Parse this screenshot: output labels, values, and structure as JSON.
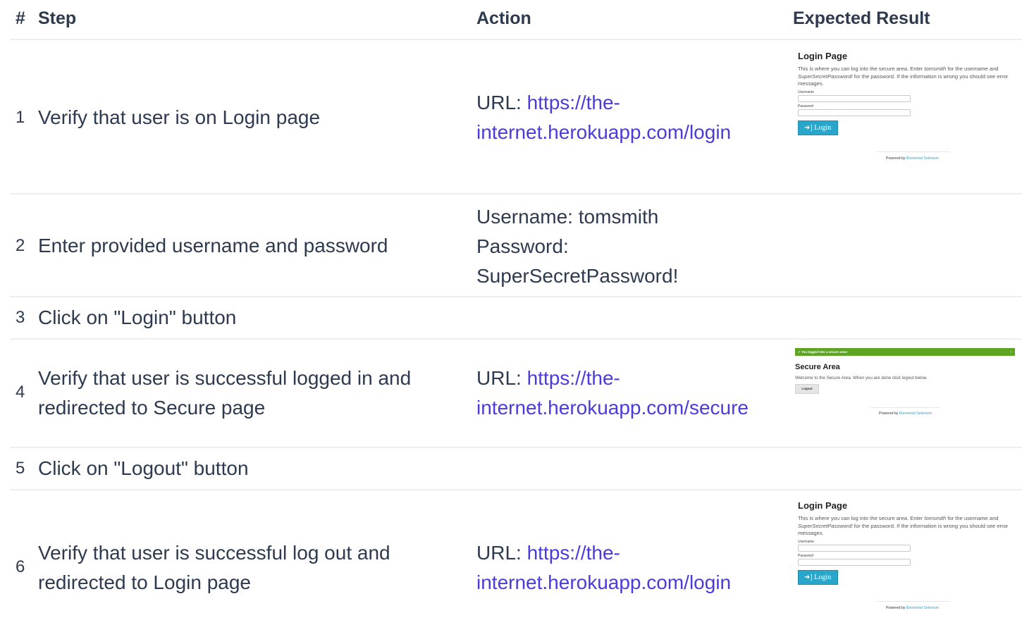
{
  "headers": {
    "num": "#",
    "step": "Step",
    "action": "Action",
    "expected": "Expected Result"
  },
  "rows": [
    {
      "num": "1",
      "step": "Verify that user is on Login page",
      "action_prefix": "URL: ",
      "action_link": "https://the-internet.herokuapp.com/login"
    },
    {
      "num": "2",
      "step": "Enter provided username and password",
      "action_lines": [
        "Username: tomsmith",
        "Password:",
        "SuperSecretPassword!"
      ]
    },
    {
      "num": "3",
      "step": "Click on \"Login\" button"
    },
    {
      "num": "4",
      "step": "Verify that user is successful logged in and redirected to Secure page",
      "action_prefix": "URL: ",
      "action_link": "https://the-internet.herokuapp.com/secure"
    },
    {
      "num": "5",
      "step": "Click on \"Logout\" button"
    },
    {
      "num": "6",
      "step": "Verify that user is successful log out and redirected to Login page",
      "action_prefix": "URL: ",
      "action_link": "https://the-internet.herokuapp.com/login"
    }
  ],
  "login_shot": {
    "title": "Login Page",
    "desc_1": "This is where you can log into the secure area. Enter ",
    "desc_user": "tomsmith",
    "desc_2": " for the username and ",
    "desc_pass": "SuperSecretPassword!",
    "desc_3": " for the password. If the information is wrong you should see error messages.",
    "username_label": "Username",
    "password_label": "Password",
    "button": "Login",
    "footer_prefix": "Powered by ",
    "footer_link": "Elemental Selenium"
  },
  "secure_shot": {
    "flash": "You logged into a secure area!",
    "flash_close": "×",
    "title": "Secure Area",
    "desc": "Welcome to the Secure Area. When you are done click logout below.",
    "button": "Logout",
    "footer_prefix": "Powered by ",
    "footer_link": "Elemental Selenium"
  },
  "colors": {
    "text": "#2d3a4f",
    "link": "#4a3cdb",
    "divider": "#eceef1",
    "login_button": "#2ba6cb",
    "flash_success": "#5da423"
  }
}
